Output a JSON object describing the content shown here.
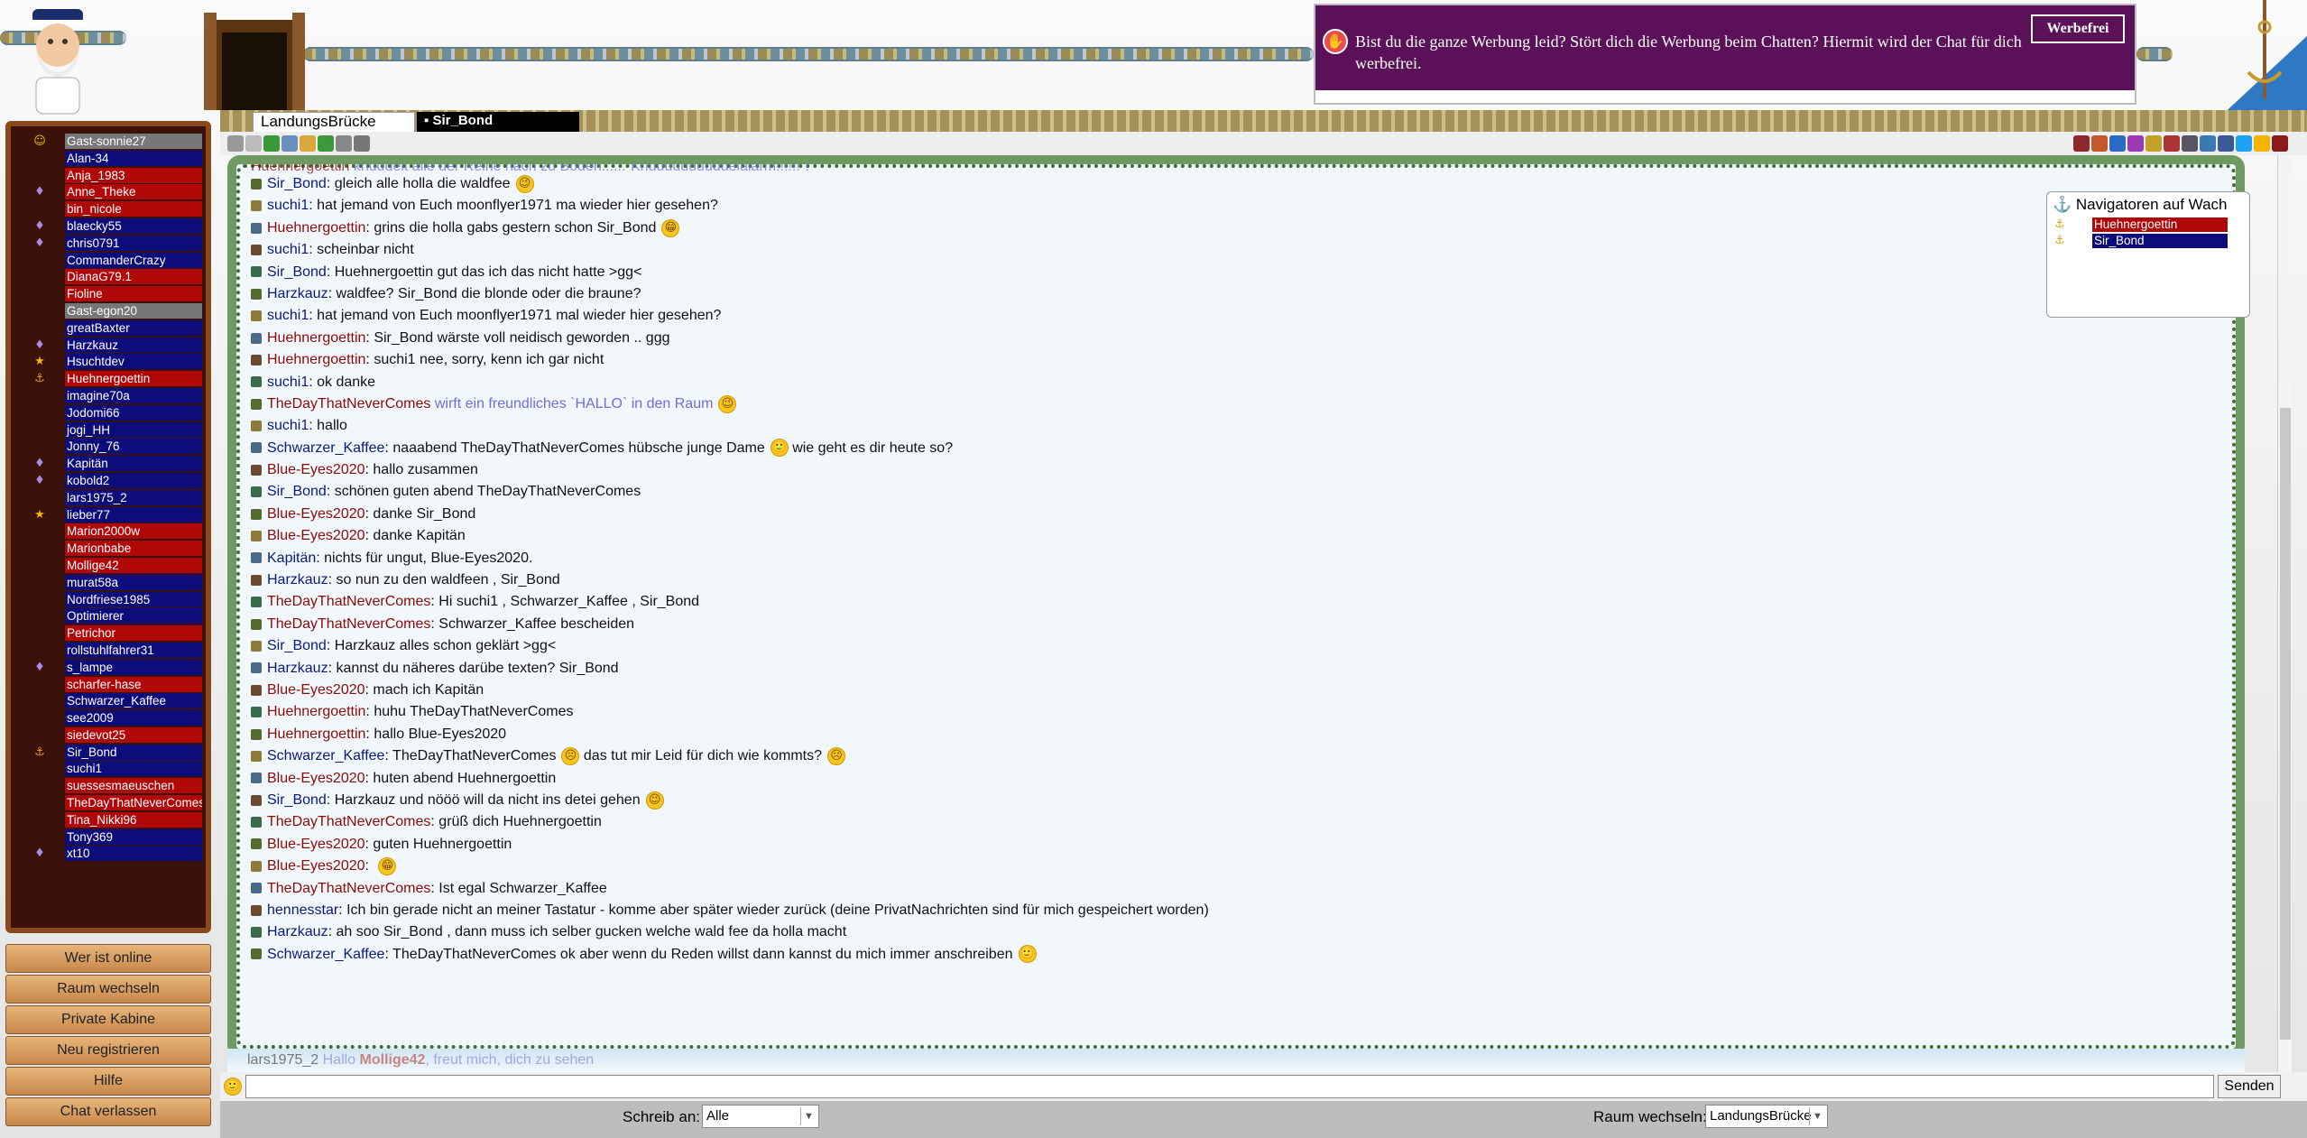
{
  "ad": {
    "text": "Bist du die ganze Werbung leid? Stört dich die Werbung beim Chatten? Hiermit wird der Chat für dich werbefrei.",
    "button": "Werbefrei"
  },
  "tabs": [
    "LandungsBrücke",
    "Sir_Bond"
  ],
  "users": [
    {
      "name": "Gast-sonnie27",
      "style": "gray",
      "icon": "smile"
    },
    {
      "name": "Alan-34",
      "style": "blue",
      "icon": ""
    },
    {
      "name": "Anja_1983",
      "style": "red",
      "icon": ""
    },
    {
      "name": "Anne_Theke",
      "style": "red",
      "icon": "gem"
    },
    {
      "name": "bin_nicole",
      "style": "red",
      "icon": ""
    },
    {
      "name": "blaecky55",
      "style": "blue",
      "icon": "gem"
    },
    {
      "name": "chris0791",
      "style": "blue",
      "icon": "gem"
    },
    {
      "name": "CommanderCrazy",
      "style": "blue",
      "icon": ""
    },
    {
      "name": "DianaG79.1",
      "style": "red",
      "icon": ""
    },
    {
      "name": "Fioline",
      "style": "red",
      "icon": ""
    },
    {
      "name": "Gast-egon20",
      "style": "gray",
      "icon": ""
    },
    {
      "name": "greatBaxter",
      "style": "blue",
      "icon": ""
    },
    {
      "name": "Harzkauz",
      "style": "blue",
      "icon": "gem"
    },
    {
      "name": "Hsuchtdev",
      "style": "blue",
      "icon": "star"
    },
    {
      "name": "Huehnergoettin",
      "style": "red",
      "icon": "anchor"
    },
    {
      "name": "imagine70a",
      "style": "blue",
      "icon": ""
    },
    {
      "name": "Jodomi66",
      "style": "blue",
      "icon": ""
    },
    {
      "name": "jogi_HH",
      "style": "blue",
      "icon": ""
    },
    {
      "name": "Jonny_76",
      "style": "blue",
      "icon": ""
    },
    {
      "name": "Kapitän",
      "style": "blue",
      "icon": "gem"
    },
    {
      "name": "kobold2",
      "style": "blue",
      "icon": "gem"
    },
    {
      "name": "lars1975_2",
      "style": "blue",
      "icon": ""
    },
    {
      "name": "lieber77",
      "style": "blue",
      "icon": "star"
    },
    {
      "name": "Marion2000w",
      "style": "red",
      "icon": ""
    },
    {
      "name": "Marionbabe",
      "style": "red",
      "icon": ""
    },
    {
      "name": "Mollige42",
      "style": "red",
      "icon": ""
    },
    {
      "name": "murat58a",
      "style": "blue",
      "icon": ""
    },
    {
      "name": "Nordfriese1985",
      "style": "blue",
      "icon": ""
    },
    {
      "name": "Optimierer",
      "style": "blue",
      "icon": ""
    },
    {
      "name": "Petrichor",
      "style": "red",
      "icon": ""
    },
    {
      "name": "rollstuhlfahrer31",
      "style": "blue",
      "icon": ""
    },
    {
      "name": "s_lampe",
      "style": "blue",
      "icon": "gem"
    },
    {
      "name": "scharfer-hase",
      "style": "red",
      "icon": ""
    },
    {
      "name": "Schwarzer_Kaffee",
      "style": "blue",
      "icon": ""
    },
    {
      "name": "see2009",
      "style": "blue",
      "icon": ""
    },
    {
      "name": "siedevot25",
      "style": "red",
      "icon": ""
    },
    {
      "name": "Sir_Bond",
      "style": "blue",
      "icon": "anchor"
    },
    {
      "name": "suchi1",
      "style": "blue",
      "icon": ""
    },
    {
      "name": "suessesmaeuschen",
      "style": "red",
      "icon": ""
    },
    {
      "name": "TheDayThatNeverComes",
      "style": "red",
      "icon": ""
    },
    {
      "name": "Tina_Nikki96",
      "style": "red",
      "icon": ""
    },
    {
      "name": "Tony369",
      "style": "blue",
      "icon": ""
    },
    {
      "name": "xt10",
      "style": "blue",
      "icon": "gem"
    }
  ],
  "nav_buttons": [
    "Wer ist online",
    "Raum wechseln",
    "Private Kabine",
    "Neu registrieren",
    "Hilfe",
    "Chat verlassen"
  ],
  "first_line": {
    "nick": "Huehnergoettin",
    "text": " knuddelt alle der Reihe nach zu Boden......\"Knuuuuuuuuddelalarm!!!!!!\"!\""
  },
  "messages": [
    {
      "nick": "Sir_Bond",
      "color": "blue",
      "text": ": gleich alle holla die waldfee",
      "emo": "wink"
    },
    {
      "nick": "suchi1",
      "color": "blue",
      "text": ": hat jemand von Euch moonflyer1971 ma wieder hier gesehen?"
    },
    {
      "nick": "Huehnergoettin",
      "color": "red",
      "text": ": grins die holla gabs gestern schon Sir_Bond",
      "emo": "grin"
    },
    {
      "nick": "suchi1",
      "color": "blue",
      "text": ": scheinbar nicht"
    },
    {
      "nick": "Sir_Bond",
      "color": "blue",
      "text": ": Huehnergoettin gut das ich das nicht hatte >gg<"
    },
    {
      "nick": "Harzkauz",
      "color": "blue",
      "text": ": waldfee? Sir_Bond die blonde oder die braune?"
    },
    {
      "nick": "suchi1",
      "color": "blue",
      "text": ": hat jemand von Euch moonflyer1971 mal wieder hier gesehen?"
    },
    {
      "nick": "Huehnergoettin",
      "color": "red",
      "text": ": Sir_Bond wärste voll neidisch geworden .. ggg"
    },
    {
      "nick": "Huehnergoettin",
      "color": "red",
      "text": ": suchi1 nee, sorry, kenn ich gar nicht"
    },
    {
      "nick": "suchi1",
      "color": "blue",
      "text": ": ok danke"
    },
    {
      "nick": "TheDayThatNeverComes",
      "color": "red",
      "text": " wirft ein freundliches `HALLO` in den Raum",
      "action": true,
      "emo": "wink"
    },
    {
      "nick": "suchi1",
      "color": "blue",
      "text": ": hallo"
    },
    {
      "nick": "Schwarzer_Kaffee",
      "color": "blue",
      "text": ": naaabend TheDayThatNeverComes hübsche junge Dame",
      "emo": "smile",
      "after": " wie geht es dir heute so?"
    },
    {
      "nick": "Blue-Eyes2020",
      "color": "red",
      "text": ": hallo zusammen"
    },
    {
      "nick": "Sir_Bond",
      "color": "blue",
      "text": ": schönen guten abend TheDayThatNeverComes"
    },
    {
      "nick": "Blue-Eyes2020",
      "color": "red",
      "text": ": danke Sir_Bond"
    },
    {
      "nick": "Blue-Eyes2020",
      "color": "red",
      "text": ": danke Kapitän"
    },
    {
      "nick": "Kapitän",
      "color": "blue",
      "text": ": nichts für ungut, Blue-Eyes2020."
    },
    {
      "nick": "Harzkauz",
      "color": "blue",
      "text": ": so nun zu den waldfeen , Sir_Bond"
    },
    {
      "nick": "TheDayThatNeverComes",
      "color": "red",
      "text": ": Hi suchi1 , Schwarzer_Kaffee , Sir_Bond"
    },
    {
      "nick": "TheDayThatNeverComes",
      "color": "red",
      "text": ": Schwarzer_Kaffee bescheiden"
    },
    {
      "nick": "Sir_Bond",
      "color": "blue",
      "text": ": Harzkauz alles schon geklärt >gg<"
    },
    {
      "nick": "Harzkauz",
      "color": "blue",
      "text": ": kannst du näheres darübe texten? Sir_Bond"
    },
    {
      "nick": "Blue-Eyes2020",
      "color": "red",
      "text": ": mach ich Kapitän"
    },
    {
      "nick": "Huehnergoettin",
      "color": "red",
      "text": ": huhu TheDayThatNeverComes"
    },
    {
      "nick": "Huehnergoettin",
      "color": "red",
      "text": ": hallo Blue-Eyes2020"
    },
    {
      "nick": "Schwarzer_Kaffee",
      "color": "blue",
      "text": ": TheDayThatNeverComes",
      "emo": "sad",
      "after": " das tut mir Leid für dich wie kommts?",
      "emo2": "sad"
    },
    {
      "nick": "Blue-Eyes2020",
      "color": "red",
      "text": ": huten abend Huehnergoettin"
    },
    {
      "nick": "Sir_Bond",
      "color": "blue",
      "text": ": Harzkauz und nööö will da nicht ins detei gehen",
      "emo": "wink"
    },
    {
      "nick": "TheDayThatNeverComes",
      "color": "red",
      "text": ": grüß dich Huehnergoettin"
    },
    {
      "nick": "Blue-Eyes2020",
      "color": "red",
      "text": ": guten Huehnergoettin"
    },
    {
      "nick": "Blue-Eyes2020",
      "color": "red",
      "text": ": ",
      "emo": "grin"
    },
    {
      "nick": "TheDayThatNeverComes",
      "color": "red",
      "text": ": Ist egal Schwarzer_Kaffee"
    },
    {
      "nick": "hennesstar",
      "color": "blue",
      "text": ": Ich bin gerade nicht an meiner Tastatur - komme aber später wieder zurück (deine PrivatNachrichten sind für mich gespeichert worden)"
    },
    {
      "nick": "Harzkauz",
      "color": "blue",
      "text": ": ah soo Sir_Bond , dann muss ich selber gucken welche wald fee da holla macht"
    },
    {
      "nick": "Schwarzer_Kaffee",
      "color": "blue",
      "text": ": TheDayThatNeverComes ok aber wenn du Reden willst dann kannst du mich immer anschreiben",
      "emo": "smile"
    }
  ],
  "typing": {
    "nick": "lars1975_2",
    "pre": " Hallo ",
    "target": "Mollige42",
    "post": ", freut mich, dich zu sehen"
  },
  "navigators": {
    "title": "Navigatoren auf Wach",
    "names": [
      "Huehnergoettin",
      "Sir_Bond"
    ]
  },
  "input": {
    "placeholder": "",
    "send": "Senden"
  },
  "bottom": {
    "schreib_label": "Schreib an:",
    "schreib_value": "Alle",
    "raum_label": "Raum wechseln:",
    "raum_value": "LandungsBrücke"
  },
  "emo_glyphs": {
    "wink": "😉",
    "grin": "😁",
    "smile": "🙂",
    "sad": "☹"
  },
  "colors": {
    "ad_bg": "#5b1157",
    "user_blue": "#0c0c7a",
    "user_red": "#b00808",
    "panel_bg": "#3b1209"
  }
}
